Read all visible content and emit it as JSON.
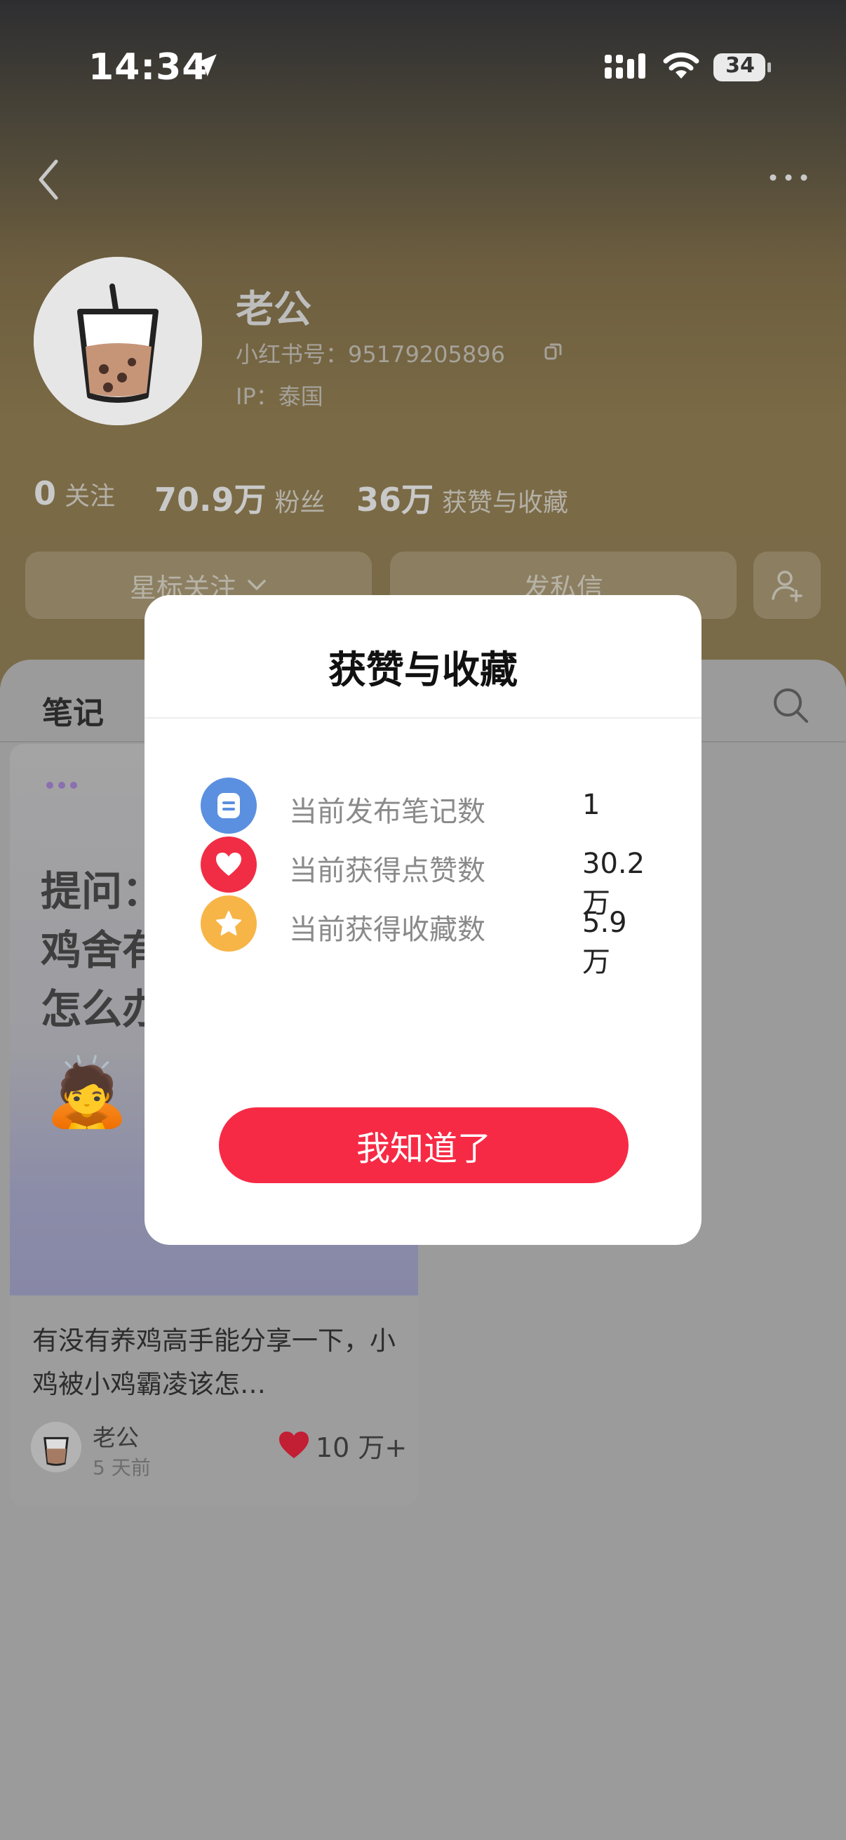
{
  "status_bar": {
    "time": "14:34",
    "battery": "34"
  },
  "profile": {
    "name": "老公",
    "id_line": "小红书号：95179205896",
    "ip_line": "IP：泰国"
  },
  "stats": {
    "following_count": "0",
    "following_label": "关注",
    "fans_count": "70.9万",
    "fans_label": "粉丝",
    "likes_count": "36万",
    "likes_label": "获赞与收藏"
  },
  "actions": {
    "star_follow": "星标关注",
    "message": "发私信"
  },
  "tabs": {
    "notes": "笔记"
  },
  "note_card": {
    "image_text": "提问：\n鸡舍有\n怎么办",
    "emoji": "🙇",
    "title": "有没有养鸡高手能分享一下，小鸡被小鸡霸凌该怎…",
    "author": "老公",
    "time": "5 天前",
    "likes": "10 万+"
  },
  "modal": {
    "title": "获赞与收藏",
    "rows": [
      {
        "label": "当前发布笔记数",
        "value": "1",
        "icon": "note-icon",
        "color": "#5b8fe0"
      },
      {
        "label": "当前获得点赞数",
        "value": "30.2万",
        "icon": "heart-icon",
        "color": "#f12d45"
      },
      {
        "label": "当前获得收藏数",
        "value": "5.9万",
        "icon": "star-icon",
        "color": "#f7b548"
      }
    ],
    "button": "我知道了"
  }
}
